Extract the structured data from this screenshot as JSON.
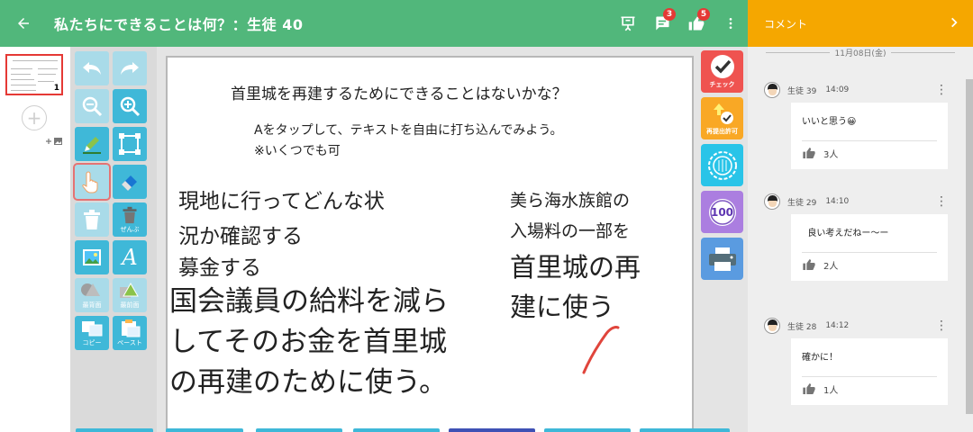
{
  "header": {
    "title": "私たちにできることは何？：生徒 40",
    "comment_badge": "3",
    "like_badge": "5"
  },
  "pages": {
    "thumbnail_number": "1"
  },
  "tools": {
    "duplicate_label": "複製",
    "delete_all_label": "ぜんぶ",
    "back_label": "最背面",
    "front_label": "最前面",
    "copy_label": "コピー",
    "paste_label": "ペースト"
  },
  "canvas": {
    "prompt_title": "首里城を再建するためにできることはないかな？",
    "instruction_1": "Aをタップして、テキストを自由に打ち込んでみよう。",
    "instruction_2": "※いくつでも可",
    "text_a1": "現地に行ってどんな状",
    "text_a2": "況か確認する",
    "text_b": "募金する",
    "text_c1": "国会議員の給料を減ら",
    "text_c2": "してそのお金を首里城",
    "text_c3": "の再建のために使う。",
    "text_d1": "美ら海水族館の",
    "text_d2": "入場料の一部を",
    "text_d3": "首里城の再",
    "text_d4": "建に使う"
  },
  "right_tools": {
    "check_label": "チェック",
    "resubmit_label": "再提出許可",
    "score_label": "100"
  },
  "comments": {
    "panel_title": "コメント",
    "date": "11月08日(金)",
    "items": [
      {
        "author": "生徒 39",
        "time": "14:09",
        "text": "いいと思う😀",
        "likes": "3人"
      },
      {
        "author": "生徒 29",
        "time": "14:10",
        "text": "  良い考えだねー～ー",
        "likes": "2人"
      },
      {
        "author": "生徒 28",
        "time": "14:12",
        "text": "確かに！",
        "likes": "1人"
      }
    ]
  },
  "colors": {
    "header_green": "#51b77b",
    "comment_orange": "#f5a700",
    "tool_blue": "#3fb8d8",
    "check_red": "#ef5350",
    "resubmit_yellow": "#f9a825",
    "stamp_cyan": "#29c4e8",
    "score_purple": "#ab7ee0",
    "print_blue": "#5a9be0"
  }
}
